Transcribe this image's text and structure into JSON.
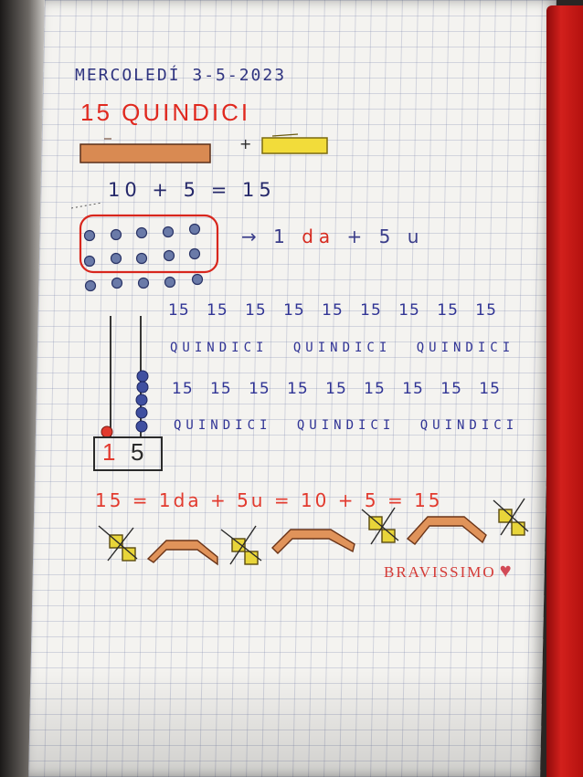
{
  "notebook": {
    "date": "MERCOLEDÍ 3-5-2023",
    "number_title": "15 QUINDICI",
    "plus_sign": "+",
    "addition": "10 + 5 = 15",
    "arrow": "→",
    "tens_one": "1",
    "tens_label": "da",
    "tens_plus": "+",
    "units_text": "5 u",
    "row_numbers_1": "15 15 15 15 15 15 15 15 15",
    "row_words_1": "QUINDICI QUINDICI QUINDICI",
    "row_numbers_2": "15 15 15 15 15 15 15 15 15",
    "row_words_2": "QUINDICI QUINDICI QUINDICI",
    "abacus_tens_digit": "1",
    "abacus_units_digit": "5",
    "final_equation": "15 = 1da + 5u = 10 + 5 = 15",
    "praise": "BRAVISSIMO",
    "heart_icon": "heart-icon",
    "colors": {
      "ink_blue": "#2f3480",
      "ink_red": "#e0291f",
      "orange_stick": "#d98a52",
      "yellow_block": "#f2dc3a"
    }
  }
}
